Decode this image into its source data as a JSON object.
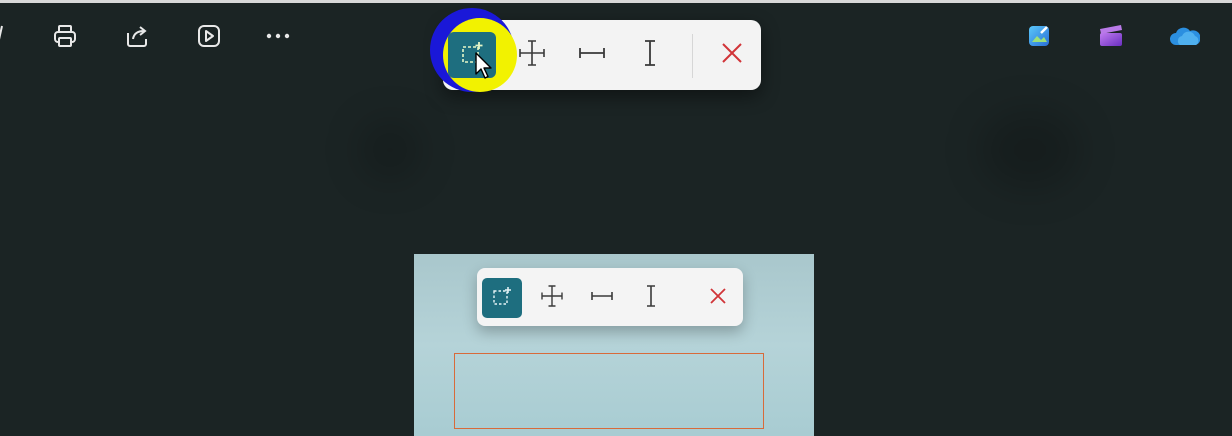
{
  "colors": {
    "background": "#1b2424",
    "toolbar_bg": "#f3f3f3",
    "selected_tool_bg": "#1e6e7f",
    "close_red": "#d13438",
    "highlight_blue": "#1a18d8",
    "highlight_yellow": "#f2f200",
    "selection_border": "#d86a3a"
  },
  "app_toolbar": {
    "icons": [
      "edit-icon",
      "print-icon",
      "share-icon",
      "slideshow-icon",
      "more-icon"
    ]
  },
  "right_apps": {
    "icons": [
      "photos-edit-icon",
      "clipchamp-icon",
      "onedrive-icon"
    ]
  },
  "measure_toolbar": {
    "tools": [
      "select-region-tool",
      "move-tool",
      "horizontal-measure-tool",
      "vertical-measure-tool",
      "close-tool"
    ],
    "selected": "select-region-tool"
  },
  "preview_toolbar": {
    "tools": [
      "select-region-tool",
      "move-tool",
      "horizontal-measure-tool",
      "vertical-measure-tool",
      "close-tool"
    ],
    "selected": "select-region-tool"
  }
}
